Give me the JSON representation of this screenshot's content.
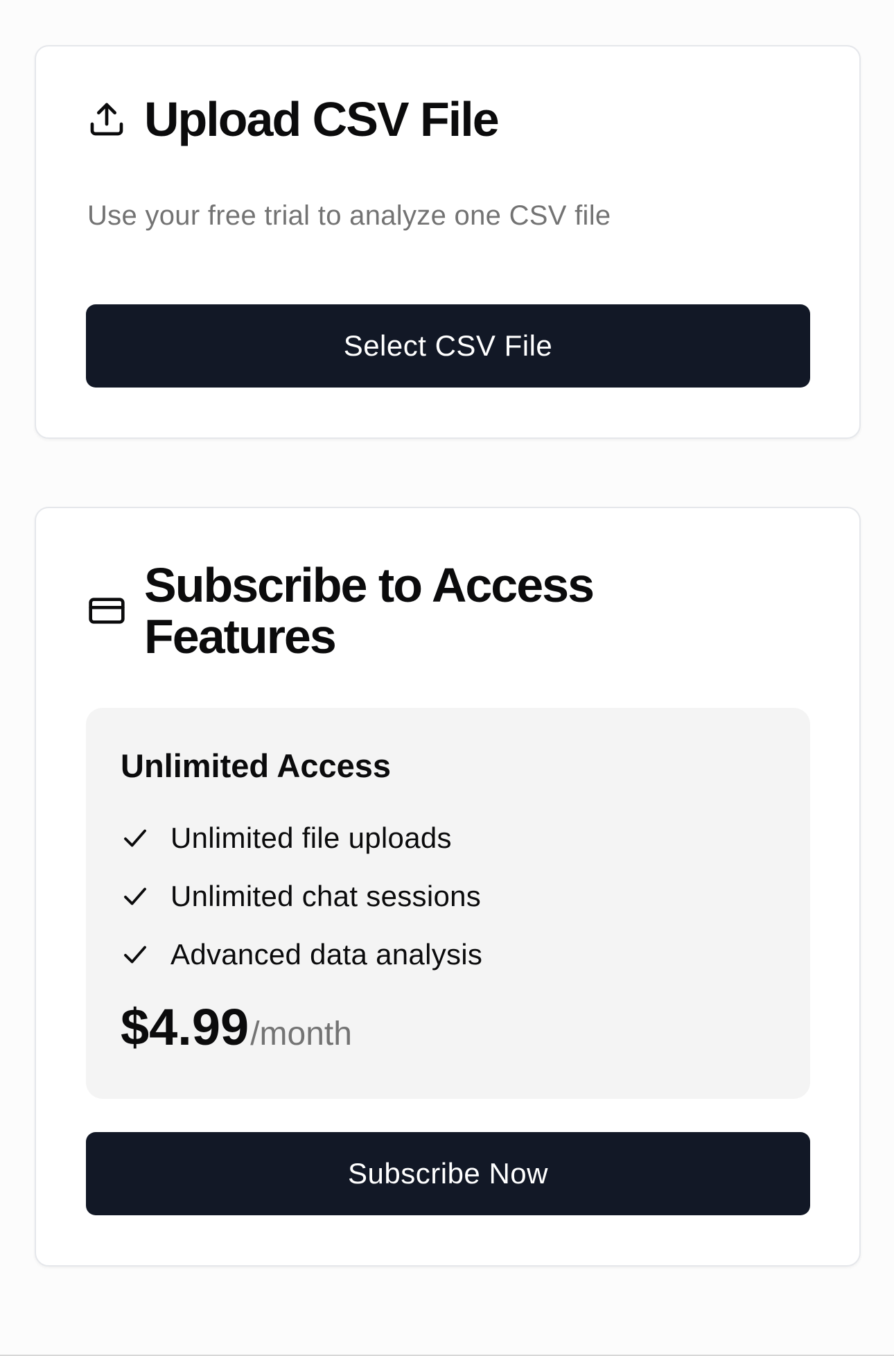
{
  "upload": {
    "title": "Upload CSV File",
    "subtitle": "Use your free trial to analyze one CSV file",
    "button_label": "Select CSV File",
    "icon": "upload-icon"
  },
  "subscribe": {
    "title": "Subscribe to Access Features",
    "icon": "credit-card-icon",
    "plan": {
      "name": "Unlimited Access",
      "features": [
        "Unlimited file uploads",
        "Unlimited chat sessions",
        "Advanced data analysis"
      ],
      "feature_icon": "check-icon",
      "price": "$4.99",
      "period": "/month"
    },
    "button_label": "Subscribe Now"
  },
  "colors": {
    "button_bg": "#121826",
    "button_text": "#ffffff",
    "muted_text": "#737373",
    "plan_bg": "#f4f4f4",
    "card_border": "#e5e7eb"
  }
}
